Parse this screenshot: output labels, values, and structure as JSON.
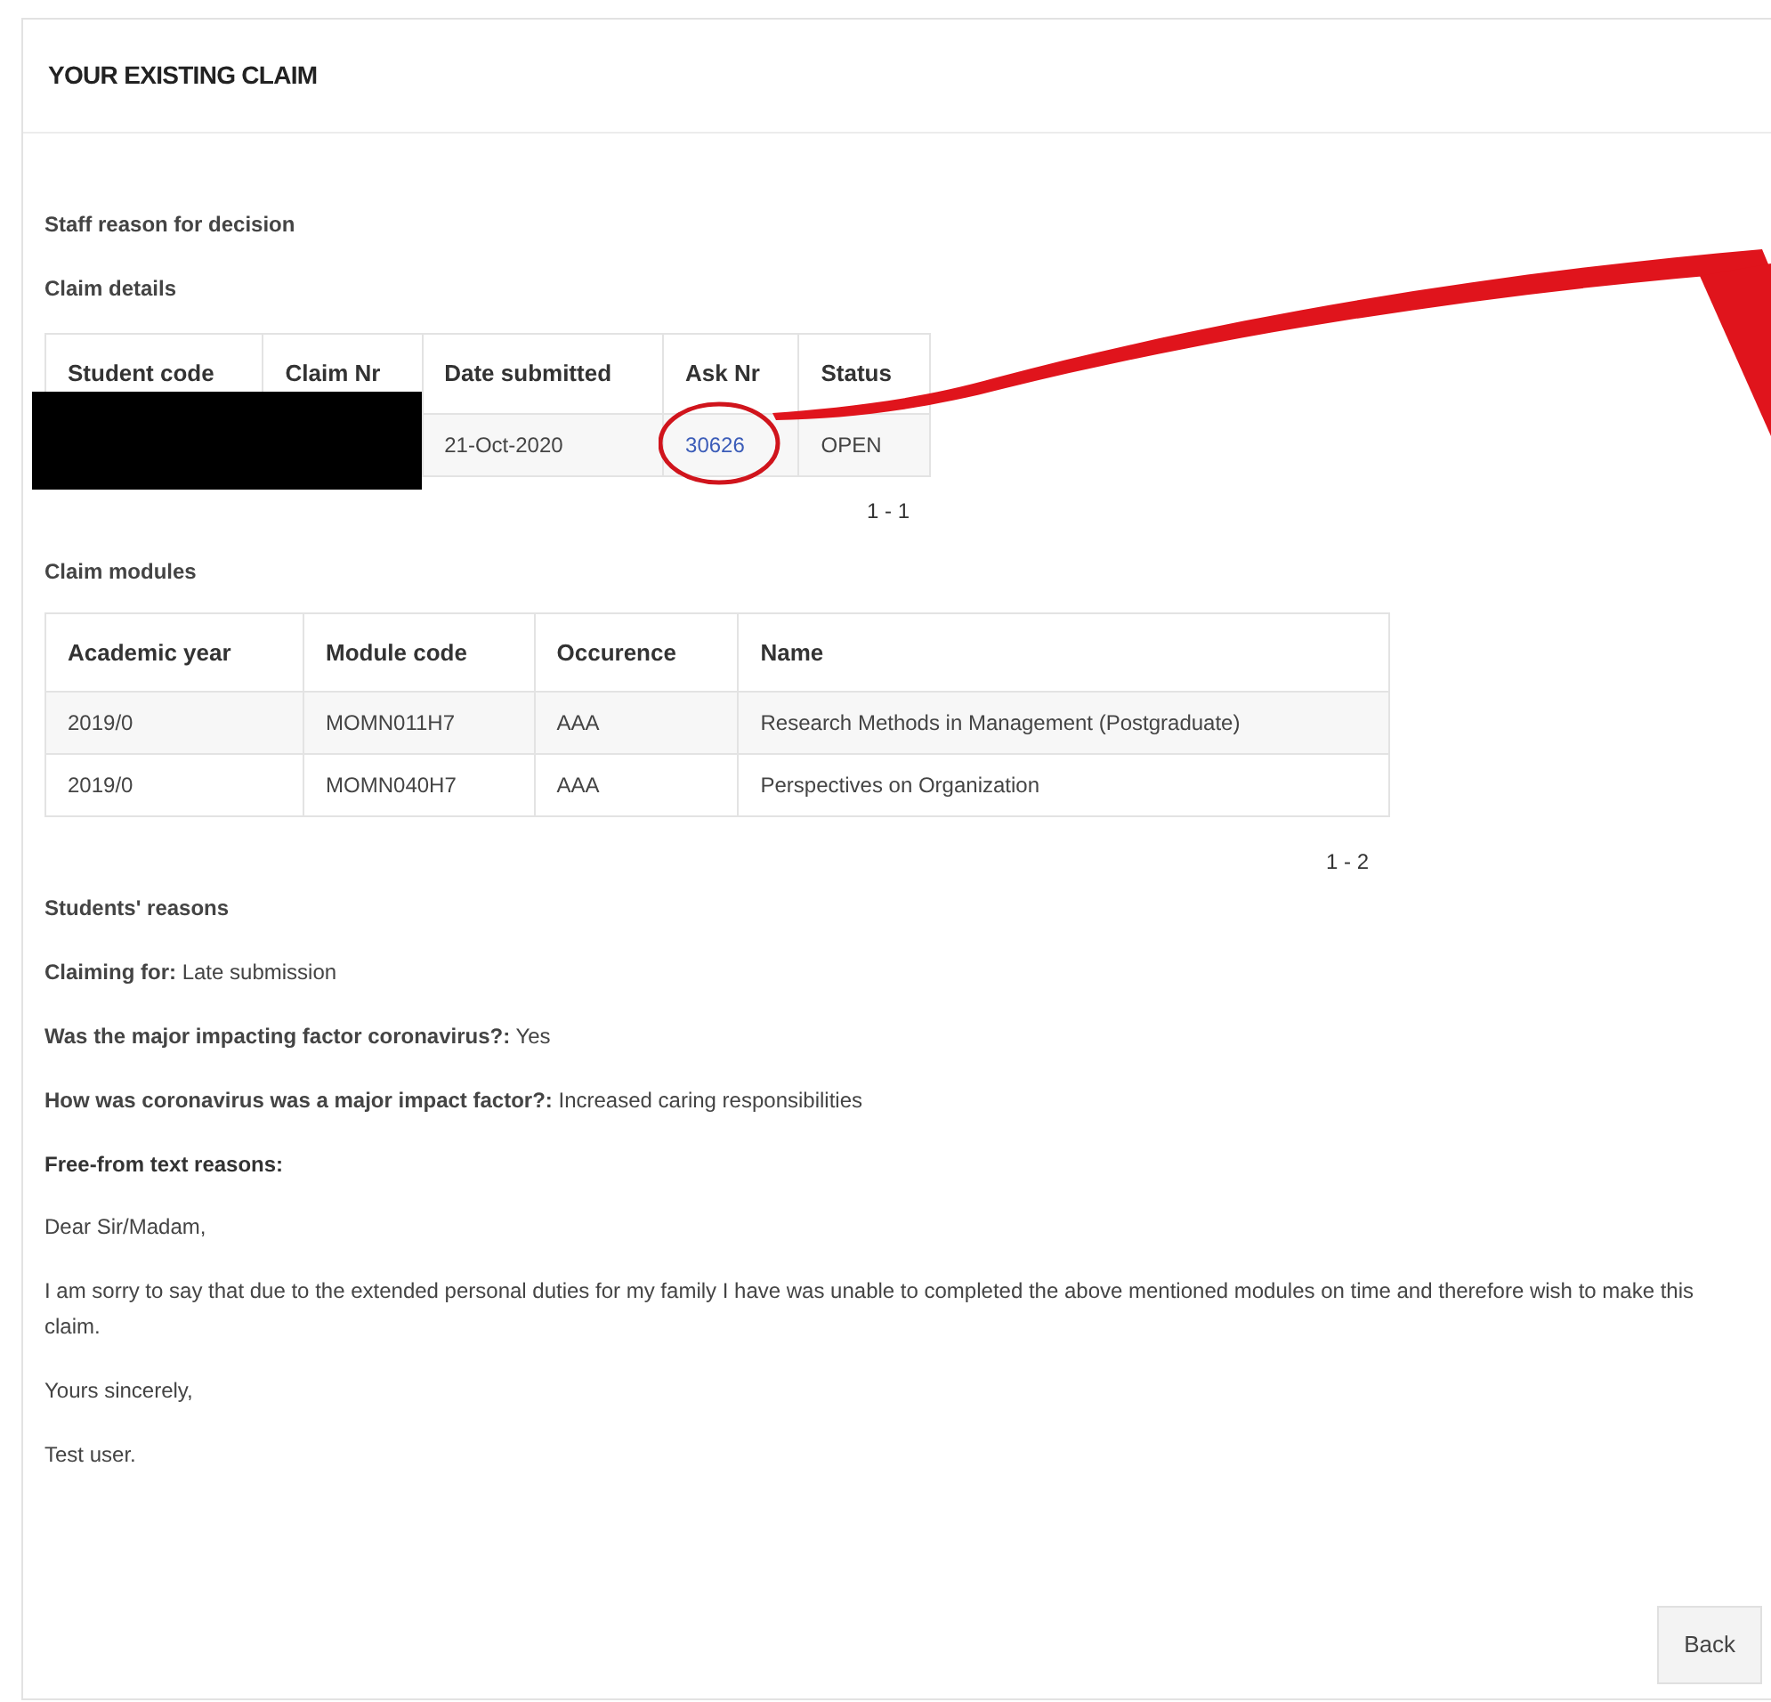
{
  "panel": {
    "title": "YOUR EXISTING CLAIM"
  },
  "staff_reason": {
    "label": "Staff reason for decision"
  },
  "claim_details": {
    "label": "Claim details",
    "columns": [
      "Student code",
      "Claim Nr",
      "Date submitted",
      "Ask Nr",
      "Status"
    ],
    "row": {
      "date_submitted": "21-Oct-2020",
      "ask_nr": "30626",
      "status": "OPEN"
    },
    "pager": "1 - 1"
  },
  "claim_modules": {
    "label": "Claim modules",
    "columns": [
      "Academic year",
      "Module code",
      "Occurence",
      "Name"
    ],
    "rows": [
      [
        "2019/0",
        "MOMN011H7",
        "AAA",
        "Research Methods in Management (Postgraduate)"
      ],
      [
        "2019/0",
        "MOMN040H7",
        "AAA",
        "Perspectives on Organization"
      ]
    ],
    "pager": "1 - 2"
  },
  "students_reasons": {
    "label": "Students' reasons",
    "lines": [
      "**Claiming for:** Late submission",
      "**Was the major impacting factor coronavirus?:** Yes",
      "**How was coronavirus was a major impact factor?:** Increased caring responsibilities"
    ],
    "free_text_label": "Free-from text reasons:",
    "paragraphs": [
      "Dear Sir/Madam,",
      "I am sorry to say that due to the extended personal duties for my family I have was unable to completed the above mentioned modules on time and therefore wish to make this claim.",
      "Yours sincerely,",
      "Test user."
    ]
  },
  "buttons": [
    "Back"
  ]
}
